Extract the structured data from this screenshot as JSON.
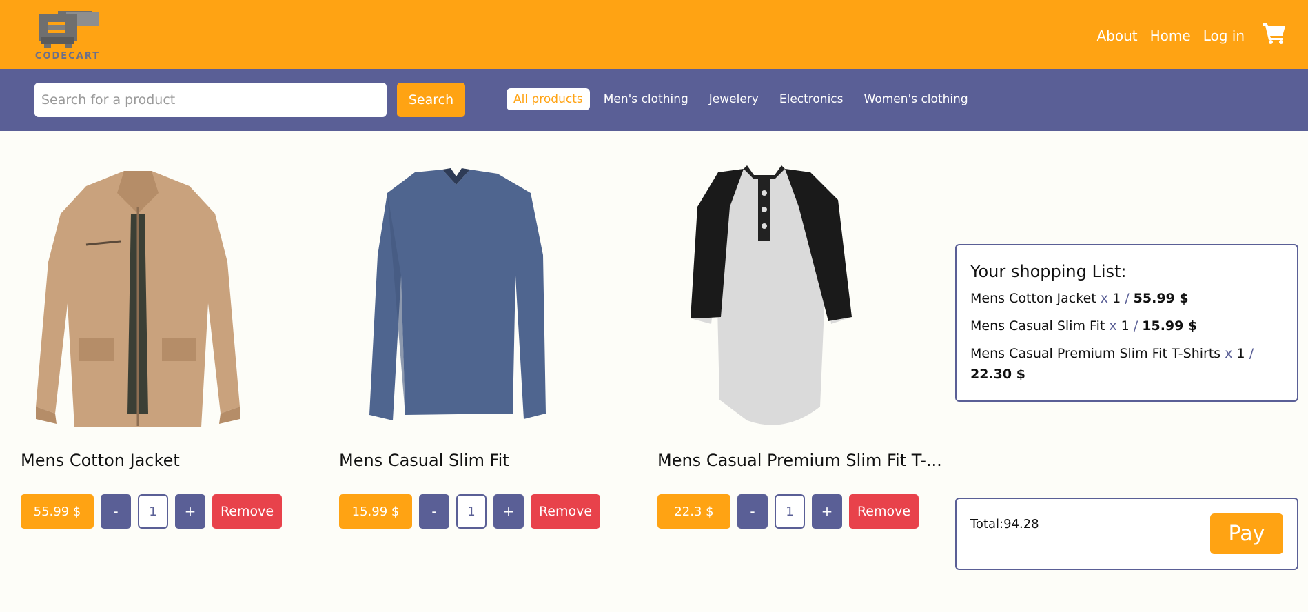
{
  "brand": {
    "name": "CODECART",
    "logo_icon": "cart-logo-icon",
    "accent": "#ffa313",
    "secondary": "#5a5f96",
    "danger": "#e8424b"
  },
  "nav": {
    "about": "About",
    "home": "Home",
    "login": "Log in",
    "cart_icon": "shopping-cart-icon"
  },
  "search": {
    "placeholder": "Search for a product",
    "button": "Search"
  },
  "categories": [
    "All products",
    "Men's clothing",
    "Jewelery",
    "Electronics",
    "Women's clothing"
  ],
  "products": [
    {
      "title": "Mens Cotton Jacket",
      "price": "55.99 $",
      "qty": "1",
      "minus": "-",
      "plus": "+",
      "remove": "Remove"
    },
    {
      "title": "Mens Casual Slim Fit",
      "price": "15.99 $",
      "qty": "1",
      "minus": "-",
      "plus": "+",
      "remove": "Remove"
    },
    {
      "title": "Mens Casual Premium Slim Fit T-...",
      "price": "22.3 $",
      "qty": "1",
      "minus": "-",
      "plus": "+",
      "remove": "Remove"
    }
  ],
  "shopping_list": {
    "title": "Your shopping List:",
    "items": [
      {
        "name": "Mens Cotton Jacket",
        "x": "x",
        "qty": "1",
        "sep": "/",
        "price": "55.99 $"
      },
      {
        "name": "Mens Casual Slim Fit",
        "x": "x",
        "qty": "1",
        "sep": "/",
        "price": "15.99 $"
      },
      {
        "name": "Mens Casual Premium Slim Fit T-Shirts",
        "x": "x",
        "qty": "1",
        "sep": "/",
        "price": "22.30 $"
      }
    ]
  },
  "total": {
    "text": "Total:94.28",
    "pay": "Pay"
  }
}
